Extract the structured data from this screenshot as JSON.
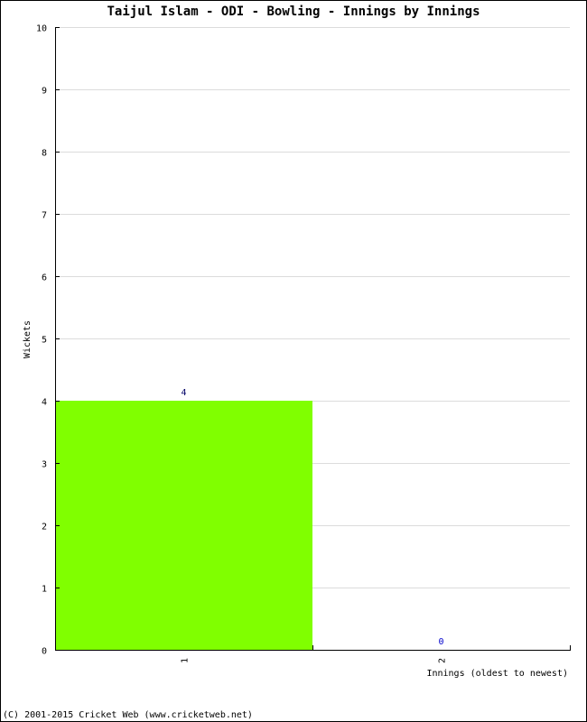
{
  "chart_data": {
    "type": "bar",
    "title": "Taijul Islam - ODI - Bowling - Innings by Innings",
    "xlabel": "Innings (oldest to newest)",
    "ylabel": "Wickets",
    "categories": [
      "1",
      "2"
    ],
    "values": [
      4,
      0
    ],
    "data_labels": [
      "4",
      "0"
    ],
    "ylim": [
      0,
      10
    ],
    "yticks": [
      0,
      1,
      2,
      3,
      4,
      5,
      6,
      7,
      8,
      9,
      10
    ],
    "grid": true,
    "legend": "none",
    "colors": {
      "bar": "#80ff00",
      "grid": "#dcdcdc",
      "axis": "#000000",
      "label_nonzero": "#000066",
      "label_zero": "#0000cc"
    }
  },
  "footer": "(C) 2001-2015 Cricket Web (www.cricketweb.net)"
}
